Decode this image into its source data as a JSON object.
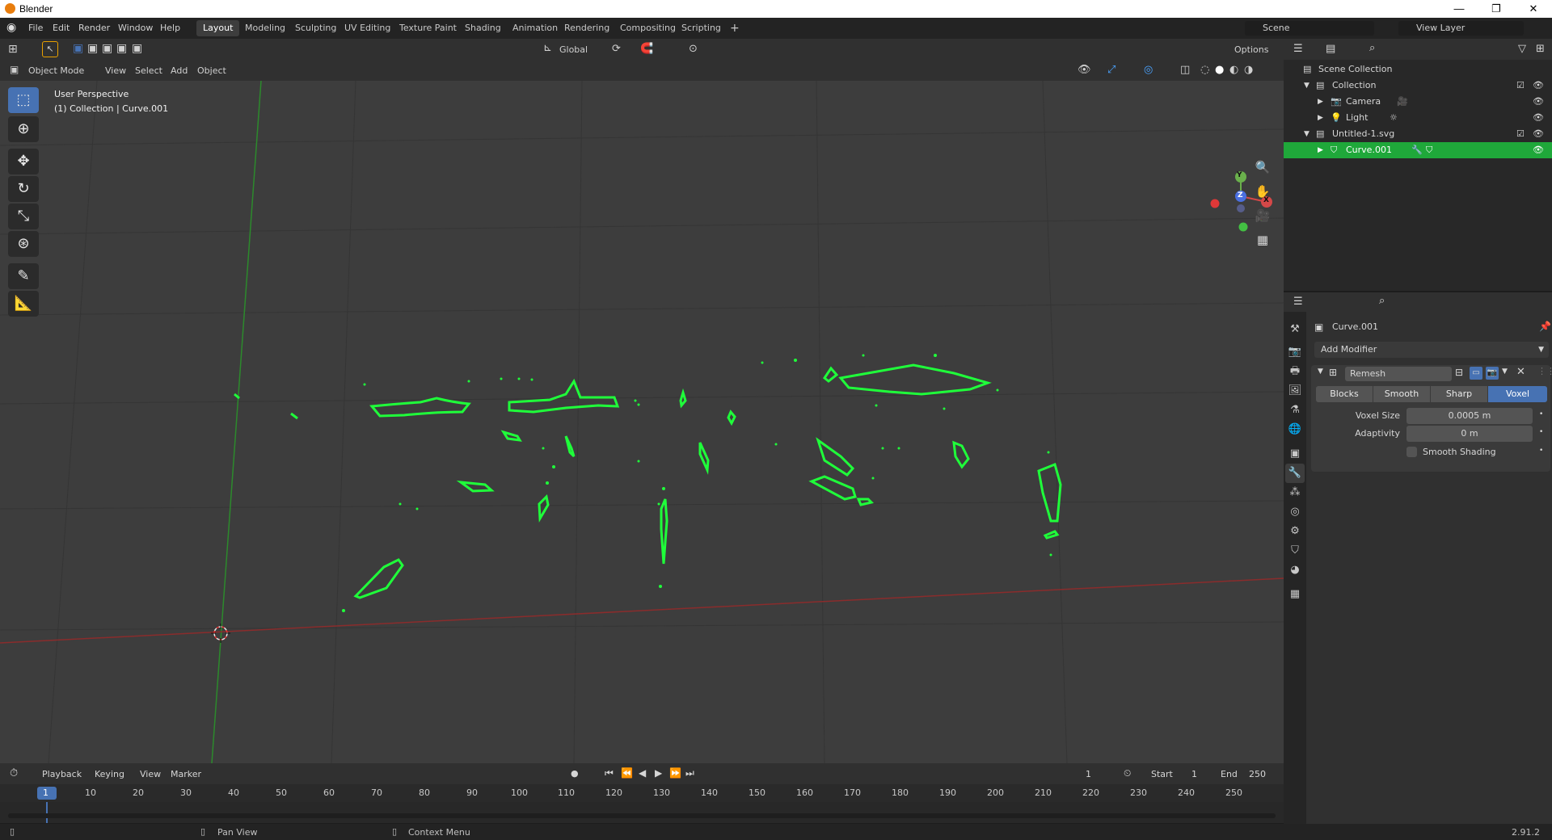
{
  "window": {
    "title": "Blender",
    "minimize": "—",
    "maximize": "❐",
    "close": "✕"
  },
  "menu": {
    "file": "File",
    "edit": "Edit",
    "render": "Render",
    "window": "Window",
    "help": "Help"
  },
  "workspaces": [
    "Layout",
    "Modeling",
    "Sculpting",
    "UV Editing",
    "Texture Paint",
    "Shading",
    "Animation",
    "Rendering",
    "Compositing",
    "Scripting"
  ],
  "add_workspace": "+",
  "scene": {
    "name": "Scene",
    "view_layer": "View Layer"
  },
  "viewport_header": {
    "mode": "Object Mode",
    "view": "View",
    "select": "Select",
    "add": "Add",
    "object": "Object",
    "transform_orientation": "Global",
    "options": "Options"
  },
  "viewport": {
    "perspective": "User Perspective",
    "collection_info": "(1) Collection | Curve.001",
    "gizmo": {
      "y": "Y",
      "z": "Z",
      "x": "X"
    },
    "accent": "#1fff3a"
  },
  "outliner": {
    "rows": [
      {
        "label": "Scene Collection",
        "depth": 0
      },
      {
        "label": "Collection",
        "depth": 1
      },
      {
        "label": "Camera",
        "depth": 2
      },
      {
        "label": "Light",
        "depth": 2
      },
      {
        "label": "Untitled-1.svg",
        "depth": 1
      },
      {
        "label": "Curve.001",
        "depth": 2
      }
    ]
  },
  "properties": {
    "object_name": "Curve.001",
    "add_modifier": "Add Modifier",
    "modifier_name": "Remesh",
    "modes": [
      "Blocks",
      "Smooth",
      "Sharp",
      "Voxel"
    ],
    "active_mode": "Voxel",
    "voxel_size_label": "Voxel Size",
    "voxel_size_value": "0.0005 m",
    "adaptivity_label": "Adaptivity",
    "adaptivity_value": "0 m",
    "smooth_shading_label": "Smooth Shading"
  },
  "timeline": {
    "playback": "Playback",
    "keying": "Keying",
    "view": "View",
    "marker": "Marker",
    "current_frame": "1",
    "start_label": "Start",
    "start_value": "1",
    "end_label": "End",
    "end_value": "250",
    "ruler": [
      "1",
      "10",
      "20",
      "30",
      "40",
      "50",
      "60",
      "70",
      "80",
      "90",
      "100",
      "110",
      "120",
      "130",
      "140",
      "150",
      "160",
      "170",
      "180",
      "190",
      "200",
      "210",
      "220",
      "230",
      "240",
      "250"
    ]
  },
  "statusbar": {
    "pan_view": "Pan View",
    "context_menu": "Context Menu",
    "version": "2.91.2"
  }
}
